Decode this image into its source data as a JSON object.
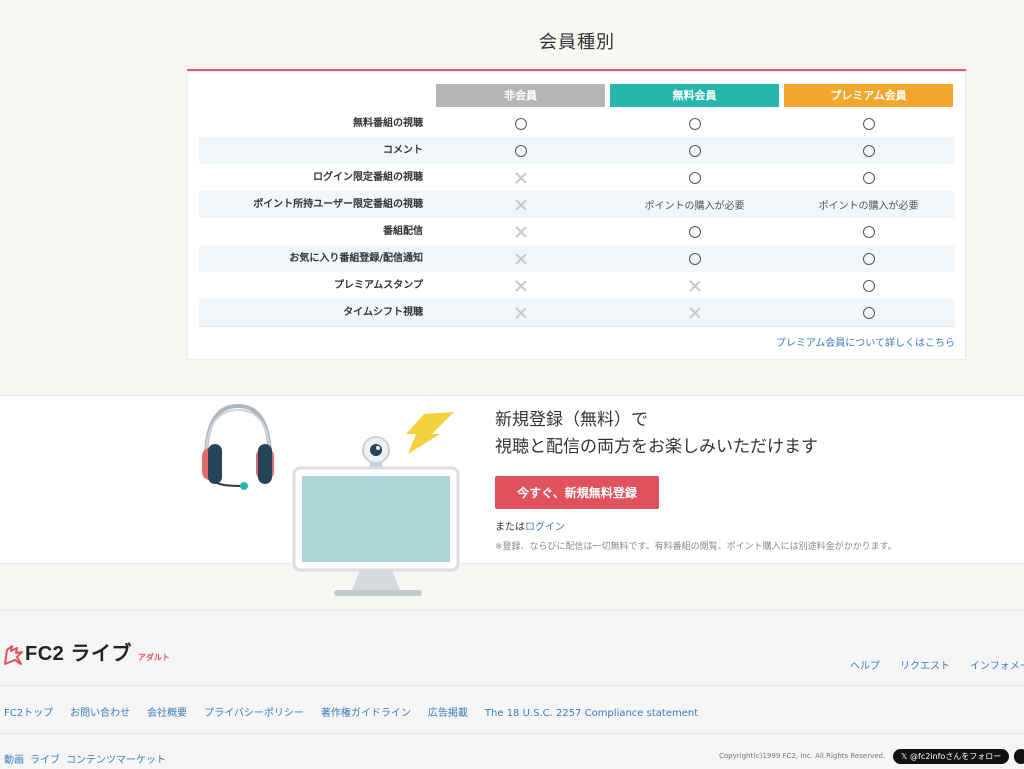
{
  "membership": {
    "title": "会員種別",
    "columns": [
      "非会員",
      "無料会員",
      "プレミアム会員"
    ],
    "rows": [
      {
        "label": "無料番組の視聴",
        "values": [
          "o",
          "o",
          "o"
        ]
      },
      {
        "label": "コメント",
        "values": [
          "o",
          "o",
          "o"
        ]
      },
      {
        "label": "ログイン限定番組の視聴",
        "values": [
          "x",
          "o",
          "o"
        ]
      },
      {
        "label": "ポイント所持ユーザー限定番組の視聴",
        "values": [
          "x",
          "ポイントの購入が必要",
          "ポイントの購入が必要"
        ]
      },
      {
        "label": "番組配信",
        "values": [
          "x",
          "o",
          "o"
        ]
      },
      {
        "label": "お気に入り番組登録/配信通知",
        "values": [
          "x",
          "o",
          "o"
        ]
      },
      {
        "label": "プレミアムスタンプ",
        "values": [
          "x",
          "x",
          "o"
        ]
      },
      {
        "label": "タイムシフト視聴",
        "values": [
          "x",
          "x",
          "o"
        ]
      }
    ],
    "more_link": "プレミアム会員について詳しくはこちら"
  },
  "registration": {
    "heading_line1": "新規登録（無料）で",
    "heading_line2": "視聴と配信の両方をお楽しみいただけます",
    "button_label": "今すぐ、新規無料登録",
    "or_text": "または",
    "login_link": "ログイン",
    "note": "※登録、ならびに配信は一切無料です。有料番組の閲覧、ポイント購入には別途料金がかかります。"
  },
  "footer": {
    "logo_text": "FC2 ライブ",
    "logo_sub": "アダルト",
    "nav": [
      "ヘルプ",
      "リクエスト",
      "インフォメーション"
    ],
    "links": [
      "FC2トップ",
      "お問い合わせ",
      "会社概要",
      "プライバシーポリシー",
      "著作権ガイドライン",
      "広告掲載",
      "The 18 U.S.C. 2257 Compliance statement"
    ],
    "service_links": [
      "動画",
      "ライブ",
      "コンテンツマーケット"
    ],
    "copyright": "Copyright(c)1999 FC2, Inc. All Rights Reserved.",
    "x_follow": "@fc2infoさんをフォロー"
  }
}
